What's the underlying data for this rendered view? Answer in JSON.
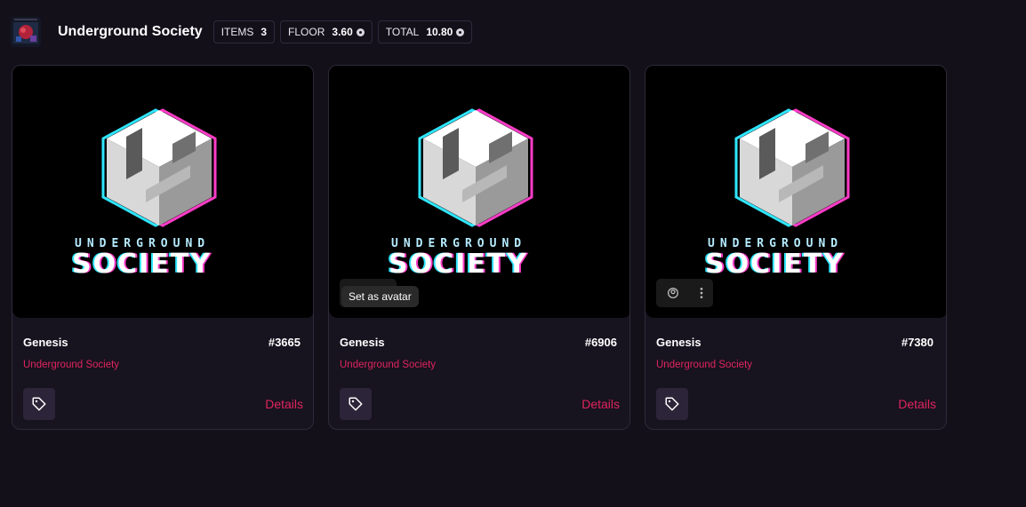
{
  "header": {
    "title": "Underground Society",
    "stats": [
      {
        "label": "ITEMS",
        "value": "3",
        "coin": false
      },
      {
        "label": "FLOOR",
        "value": "3.60",
        "coin": true
      },
      {
        "label": "TOTAL",
        "value": "10.80",
        "coin": true
      }
    ]
  },
  "art": {
    "line1": "UNDERGROUND",
    "line2": "SOCIETY"
  },
  "cards": [
    {
      "name": "Genesis",
      "number": "#3665",
      "collection": "Underground Society",
      "details_label": "Details"
    },
    {
      "name": "Genesis",
      "number": "#6906",
      "collection": "Underground Society",
      "details_label": "Details"
    },
    {
      "name": "Genesis",
      "number": "#7380",
      "collection": "Underground Society",
      "details_label": "Details"
    }
  ],
  "tooltip": {
    "text": "Set as avatar"
  },
  "colors": {
    "background": "#13101a",
    "accent": "#e0245e",
    "card_border": "#2e2a38",
    "tag_button_bg": "#2c2438"
  },
  "icons": {
    "tag": "tag-icon",
    "coin": "coin-icon",
    "avatar": "set-avatar-icon",
    "more": "more-vertical-icon"
  }
}
